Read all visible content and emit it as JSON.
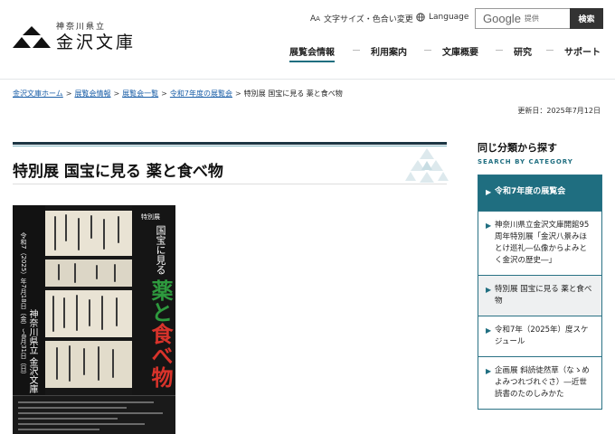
{
  "header": {
    "logo_sub": "神奈川県立",
    "logo_main": "金沢文庫",
    "text_size_label": "文字サイズ・色合い変更",
    "language_label": "Language",
    "search_brand": "Google",
    "search_placeholder": "提供",
    "search_button": "検索"
  },
  "gnav": [
    {
      "label": "展覧会情報",
      "active": true
    },
    {
      "label": "利用案内"
    },
    {
      "label": "文庫概要"
    },
    {
      "label": "研究"
    },
    {
      "label": "サポート"
    }
  ],
  "breadcrumb": {
    "items": [
      "金沢文庫ホーム",
      "展覧会情報",
      "展覧会一覧",
      "令和7年度の展覧会"
    ],
    "separator": ">",
    "current": "特別展 国宝に見る 薬と食べ物"
  },
  "updated": "更新日：2025年7月12日",
  "main": {
    "title": "特別展 国宝に見る 薬と食べ物"
  },
  "poster": {
    "tag": "特別展",
    "pre_title": "国宝に見る",
    "big_title_1": "薬と",
    "big_title_2": "食べ物",
    "date": "令和7（2025）年7月18日（金）〜8月31日（日）",
    "venue": "神奈川県立 金沢文庫",
    "colors": {
      "green": "#2e9a3e",
      "red": "#d8332b"
    }
  },
  "sidebar": {
    "title": "同じ分類から探す",
    "subtitle": "SEARCH BY CATEGORY",
    "items": [
      {
        "label": "令和7年度の展覧会",
        "type": "head"
      },
      {
        "label": "神奈川県立金沢文庫開館95周年特別展「金沢八景みほとけ巡礼―仏像からよみとく金沢の歴史―」"
      },
      {
        "label": "特別展 国宝に見る 薬と食べ物",
        "type": "current"
      },
      {
        "label": "令和7年（2025年）度スケジュール"
      },
      {
        "label": "企画展 斜読徒然草（なゝめよみつれづれぐさ）―近世読書のたのしみかた"
      }
    ]
  },
  "colors": {
    "accent": "#1f6e80",
    "link": "#1b5fa8",
    "title_rule": "#1d3644"
  }
}
